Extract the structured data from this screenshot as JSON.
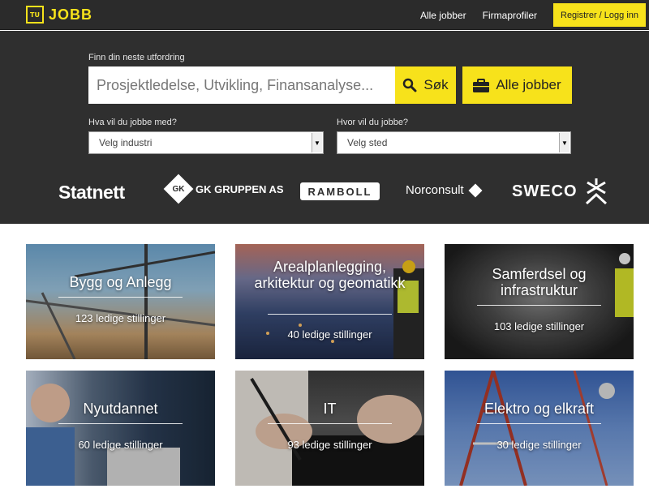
{
  "header": {
    "logo_mark": "TU",
    "logo_text": "JOBB",
    "nav": {
      "all_jobs": "Alle jobber",
      "company_profiles": "Firmaprofiler",
      "register_login": "Registrer / Logg inn"
    }
  },
  "search": {
    "label": "Finn din neste utfordring",
    "placeholder": "Prosjektledelse, Utvikling, Finansanalyse...",
    "search_button": "Søk",
    "all_jobs_button": "Alle jobber",
    "industry_label": "Hva vil du jobbe med?",
    "industry_value": "Velg industri",
    "location_label": "Hvor vil du jobbe?",
    "location_value": "Velg sted"
  },
  "brands": {
    "statnett": "Statnett",
    "gk_mark": "GK",
    "gk": "GK GRUPPEN AS",
    "ramboll": "RAMBOLL",
    "norconsult": "Norconsult",
    "sweco": "SWECO"
  },
  "categories": [
    {
      "title": "Bygg og Anlegg",
      "count": "123 ledige stillinger"
    },
    {
      "title": "Arealplanlegging, arkitektur og geomatikk",
      "count": "40 ledige stillinger"
    },
    {
      "title": "Samferdsel og infrastruktur",
      "count": "103 ledige stillinger"
    },
    {
      "title": "Nyutdannet",
      "count": "60 ledige stillinger"
    },
    {
      "title": "IT",
      "count": "93 ledige stillinger"
    },
    {
      "title": "Elektro og elkraft",
      "count": "30 ledige stillinger"
    }
  ],
  "colors": {
    "accent": "#f7e21b",
    "header_bg": "#2b2b2b",
    "hero_bg": "#2f2f2f"
  }
}
